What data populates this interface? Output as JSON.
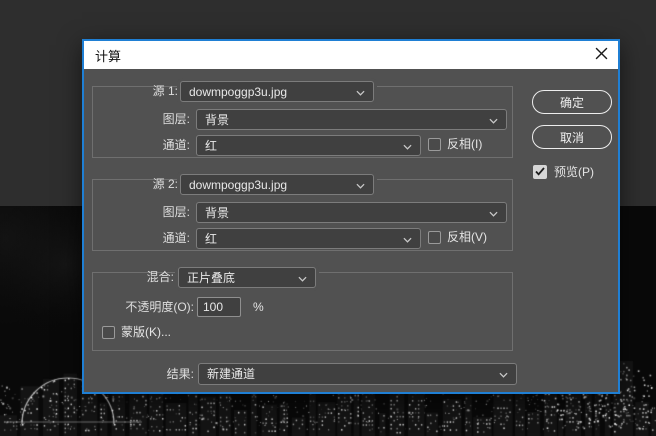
{
  "dialog": {
    "title": "计算"
  },
  "source1": {
    "label": "源 1:",
    "file": "dowmpoggp3u.jpg",
    "layer_label": "图层:",
    "layer": "背景",
    "channel_label": "通道:",
    "channel": "红",
    "invert_label": "反相(I)",
    "invert_checked": false
  },
  "source2": {
    "label": "源 2:",
    "file": "dowmpoggp3u.jpg",
    "layer_label": "图层:",
    "layer": "背景",
    "channel_label": "通道:",
    "channel": "红",
    "invert_label": "反相(V)",
    "invert_checked": false
  },
  "blend": {
    "label": "混合:",
    "mode": "正片叠底",
    "opacity_label": "不透明度(O):",
    "opacity_value": "100",
    "opacity_unit": "%",
    "mask_label": "蒙版(K)...",
    "mask_checked": false
  },
  "result": {
    "label": "结果:",
    "value": "新建通道"
  },
  "actions": {
    "ok": "确定",
    "cancel": "取消"
  },
  "preview": {
    "label": "预览(P)",
    "checked": true
  },
  "colors": {
    "dialog_border": "#1f7fd4",
    "titlebar_bg": "#ffffff",
    "content_bg": "#515151",
    "control_bg": "#404040",
    "text": "#e4e4e4",
    "app_background": "#2e2e2e"
  }
}
